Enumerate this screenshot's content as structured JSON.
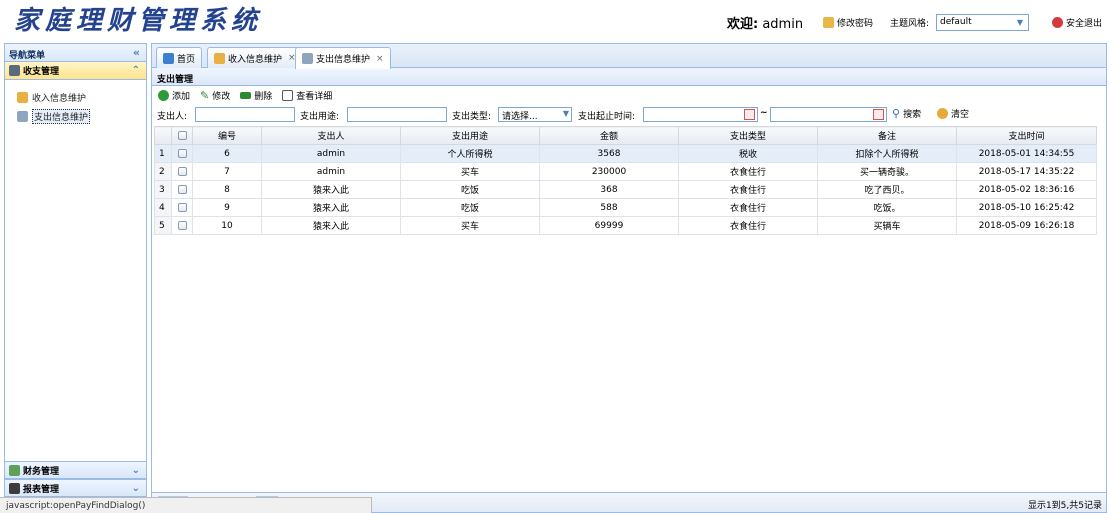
{
  "app": {
    "title": "家庭理财管理系统"
  },
  "header": {
    "welcome_label": "欢迎:",
    "username": "admin",
    "change_password": "修改密码",
    "theme_label": "主题风格:",
    "theme_value": "default",
    "logout": "安全退出"
  },
  "nav": {
    "title": "导航菜单",
    "groups": [
      {
        "label": "收支管理",
        "items": [
          {
            "label": "收入信息维护"
          },
          {
            "label": "支出信息维护"
          }
        ]
      },
      {
        "label": "财务管理"
      },
      {
        "label": "报表管理"
      }
    ]
  },
  "tabs": [
    {
      "label": "首页"
    },
    {
      "label": "收入信息维护"
    },
    {
      "label": "支出信息维护"
    }
  ],
  "panel": {
    "title": "支出管理"
  },
  "toolbar": {
    "add": "添加",
    "edit": "修改",
    "delete": "删除",
    "view": "查看详细"
  },
  "search": {
    "payer_label": "支出人:",
    "purpose_label": "支出用途:",
    "type_label": "支出类型:",
    "type_value": "请选择...",
    "time_label": "支出起止时间:",
    "tilde": "~",
    "search_btn": "搜索",
    "clear_btn": "清空"
  },
  "table": {
    "headers": [
      "编号",
      "支出人",
      "支出用途",
      "金额",
      "支出类型",
      "备注",
      "支出时间"
    ],
    "rows": [
      {
        "rn": "1",
        "cells": [
          "6",
          "admin",
          "个人所得税",
          "3568",
          "税收",
          "扣除个人所得税",
          "2018-05-01 14:34:55"
        ]
      },
      {
        "rn": "2",
        "cells": [
          "7",
          "admin",
          "买车",
          "230000",
          "衣食住行",
          "买一辆奇骏。",
          "2018-05-17 14:35:22"
        ]
      },
      {
        "rn": "3",
        "cells": [
          "8",
          "猿来入此",
          "吃饭",
          "368",
          "衣食住行",
          "吃了西贝。",
          "2018-05-02 18:36:16"
        ]
      },
      {
        "rn": "4",
        "cells": [
          "9",
          "猿来入此",
          "吃饭",
          "588",
          "衣食住行",
          "吃饭。",
          "2018-05-10 16:25:42"
        ]
      },
      {
        "rn": "5",
        "cells": [
          "10",
          "猿来入此",
          "买车",
          "69999",
          "衣食住行",
          "买辆车",
          "2018-05-09 16:26:18"
        ]
      }
    ]
  },
  "pager": {
    "info": "显示1到5,共5记录"
  },
  "statusbar": {
    "text": "javascript:openPayFindDialog()"
  }
}
